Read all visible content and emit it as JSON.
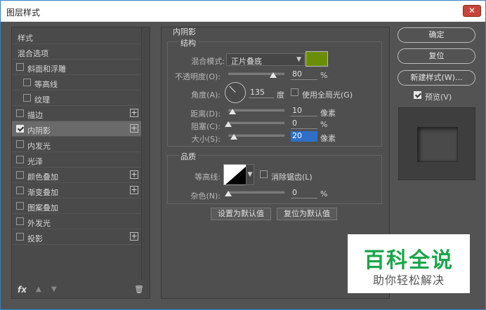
{
  "window": {
    "title": "图层样式",
    "close_label": "✕"
  },
  "left_panel": {
    "items": [
      {
        "label": "样式",
        "checkbox": false,
        "checked": false,
        "plus": false,
        "indent": 0
      },
      {
        "label": "混合选项",
        "checkbox": false,
        "checked": false,
        "plus": false,
        "indent": 0
      },
      {
        "label": "斜面和浮雕",
        "checkbox": true,
        "checked": false,
        "plus": false,
        "indent": 0
      },
      {
        "label": "等高线",
        "checkbox": true,
        "checked": false,
        "plus": false,
        "indent": 1
      },
      {
        "label": "纹理",
        "checkbox": true,
        "checked": false,
        "plus": false,
        "indent": 1
      },
      {
        "label": "描边",
        "checkbox": true,
        "checked": false,
        "plus": true,
        "indent": 0
      },
      {
        "label": "内阴影",
        "checkbox": true,
        "checked": true,
        "plus": true,
        "indent": 0,
        "active": true
      },
      {
        "label": "内发光",
        "checkbox": true,
        "checked": false,
        "plus": false,
        "indent": 0
      },
      {
        "label": "光泽",
        "checkbox": true,
        "checked": false,
        "plus": false,
        "indent": 0
      },
      {
        "label": "颜色叠加",
        "checkbox": true,
        "checked": false,
        "plus": true,
        "indent": 0
      },
      {
        "label": "渐变叠加",
        "checkbox": true,
        "checked": false,
        "plus": true,
        "indent": 0
      },
      {
        "label": "图案叠加",
        "checkbox": true,
        "checked": false,
        "plus": false,
        "indent": 0
      },
      {
        "label": "外发光",
        "checkbox": true,
        "checked": false,
        "plus": false,
        "indent": 0
      },
      {
        "label": "投影",
        "checkbox": true,
        "checked": false,
        "plus": true,
        "indent": 0
      }
    ],
    "footer": {
      "fx_label": "fx",
      "up_label": "▲",
      "down_label": "▼",
      "trash_label": "🗑"
    }
  },
  "inner_shadow": {
    "section_title": "内阴影",
    "structure": {
      "title": "结构",
      "blend_mode_label": "混合模式:",
      "blend_mode_value": "正片叠底",
      "color": "#6b8e0a",
      "opacity_label": "不透明度(O):",
      "opacity_value": "80",
      "opacity_unit": "%",
      "opacity_level": 0.8,
      "angle_label": "角度(A):",
      "angle_value": "135",
      "angle_unit": "度",
      "global_light_label": "使用全局光(G)",
      "distance_label": "距离(D):",
      "distance_value": "10",
      "distance_unit": "像素",
      "distance_level": 0.07,
      "choke_label": "阻塞(C):",
      "choke_value": "0",
      "choke_unit": "%",
      "choke_level": 0.0,
      "size_label": "大小(S):",
      "size_value": "20",
      "size_unit": "像素",
      "size_level": 0.1
    },
    "quality": {
      "title": "品质",
      "contour_label": "等高线:",
      "antialias_label": "消除锯齿(L)",
      "noise_label": "杂色(N):",
      "noise_value": "0",
      "noise_unit": "%",
      "noise_level": 0.0
    },
    "buttons": {
      "set_default": "设置为默认值",
      "reset_default": "复位为默认值"
    }
  },
  "right_panel": {
    "ok": "确定",
    "reset": "复位",
    "new_style": "新建样式(W)...",
    "preview_label": "预览(V)",
    "preview_checked": true
  },
  "watermark": {
    "main": "百科全说",
    "sub": "助你轻松解决",
    "color": "#1aa54a"
  }
}
